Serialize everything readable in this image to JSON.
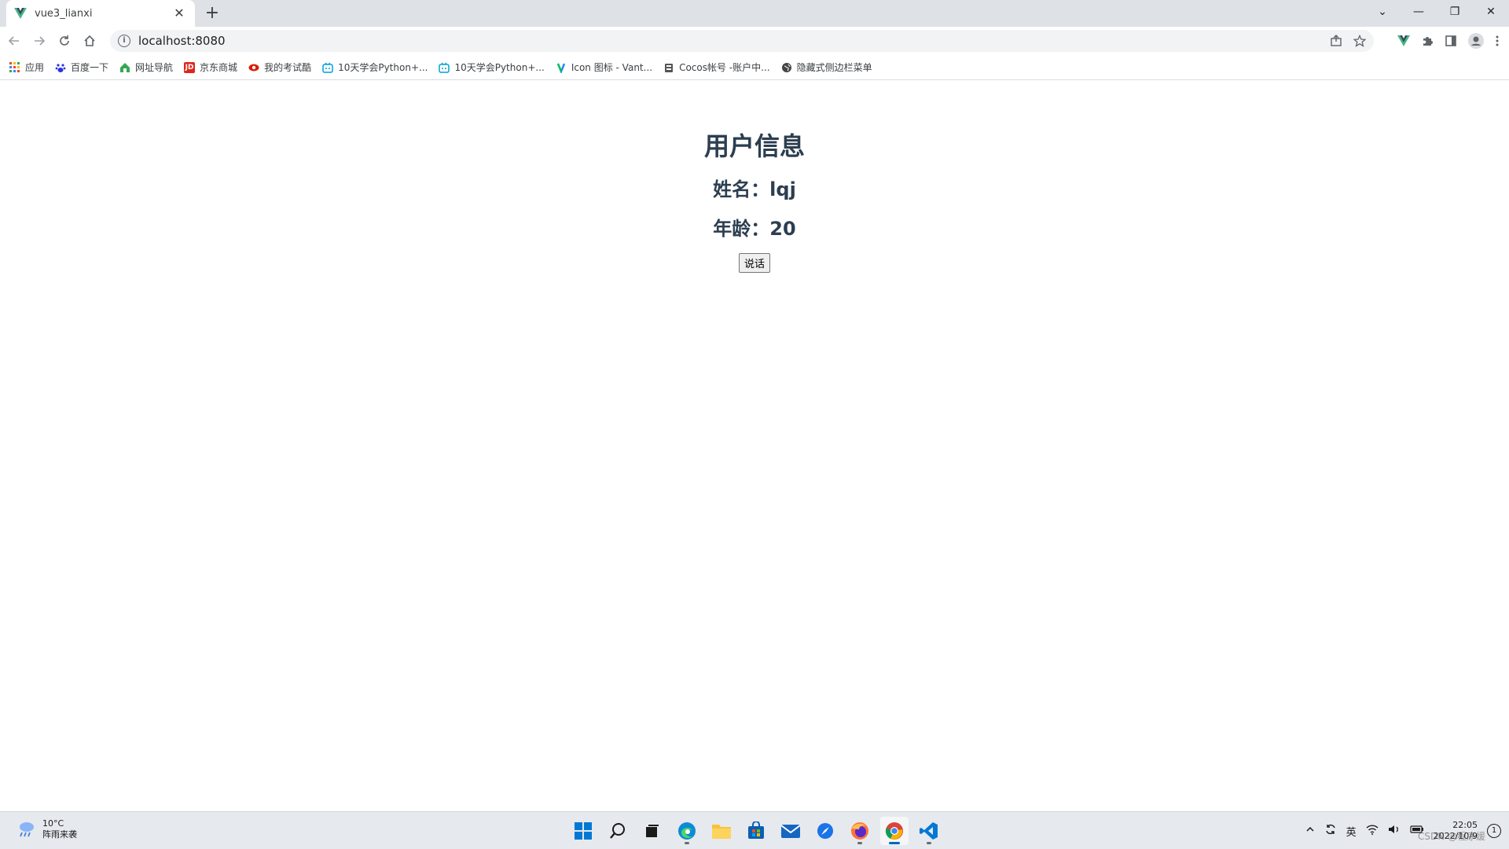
{
  "tab": {
    "title": "vue3_lianxi",
    "close": "✕",
    "new_tab": "+"
  },
  "window_controls": {
    "minimize": "—",
    "maximize": "❐",
    "close": "✕",
    "tab_search": "⌄"
  },
  "address": {
    "url": "localhost:8080",
    "info": "i"
  },
  "bookmarks": [
    {
      "label": "应用",
      "icon": "apps-grid-icon",
      "color": "#e8453c"
    },
    {
      "label": "百度一下",
      "icon": "baidu-paw-icon",
      "color": "#2932e1"
    },
    {
      "label": "网址导航",
      "icon": "nav-house-icon",
      "color": "#34a853"
    },
    {
      "label": "京东商城",
      "icon": "jd-icon",
      "color": "#e1251b"
    },
    {
      "label": "我的考试酷",
      "icon": "eye-icon",
      "color": "#d81e06"
    },
    {
      "label": "10天学会Python+...",
      "icon": "bilibili-tv-icon",
      "color": "#00a1d6"
    },
    {
      "label": "10天学会Python+...",
      "icon": "bilibili-tv-icon",
      "color": "#00a1d6"
    },
    {
      "label": "Icon 图标 - Vant...",
      "icon": "vant-icon",
      "color": "#1989fa"
    },
    {
      "label": "Cocos帐号 -账户中...",
      "icon": "cocos-icon",
      "color": "#555555"
    },
    {
      "label": "隐藏式侧边栏菜单",
      "icon": "globe-icon",
      "color": "#444444"
    }
  ],
  "page": {
    "heading": "用户信息",
    "name_line": "姓名：lqj",
    "age_line": "年龄：20",
    "speak_button": "说话"
  },
  "taskbar": {
    "weather_temp": "10°C",
    "weather_desc": "阵雨来袭",
    "ime": "英",
    "time": "22:05",
    "date": "2022/10/9",
    "notification_count": "1",
    "watermark": "CSDN @程序媛"
  }
}
